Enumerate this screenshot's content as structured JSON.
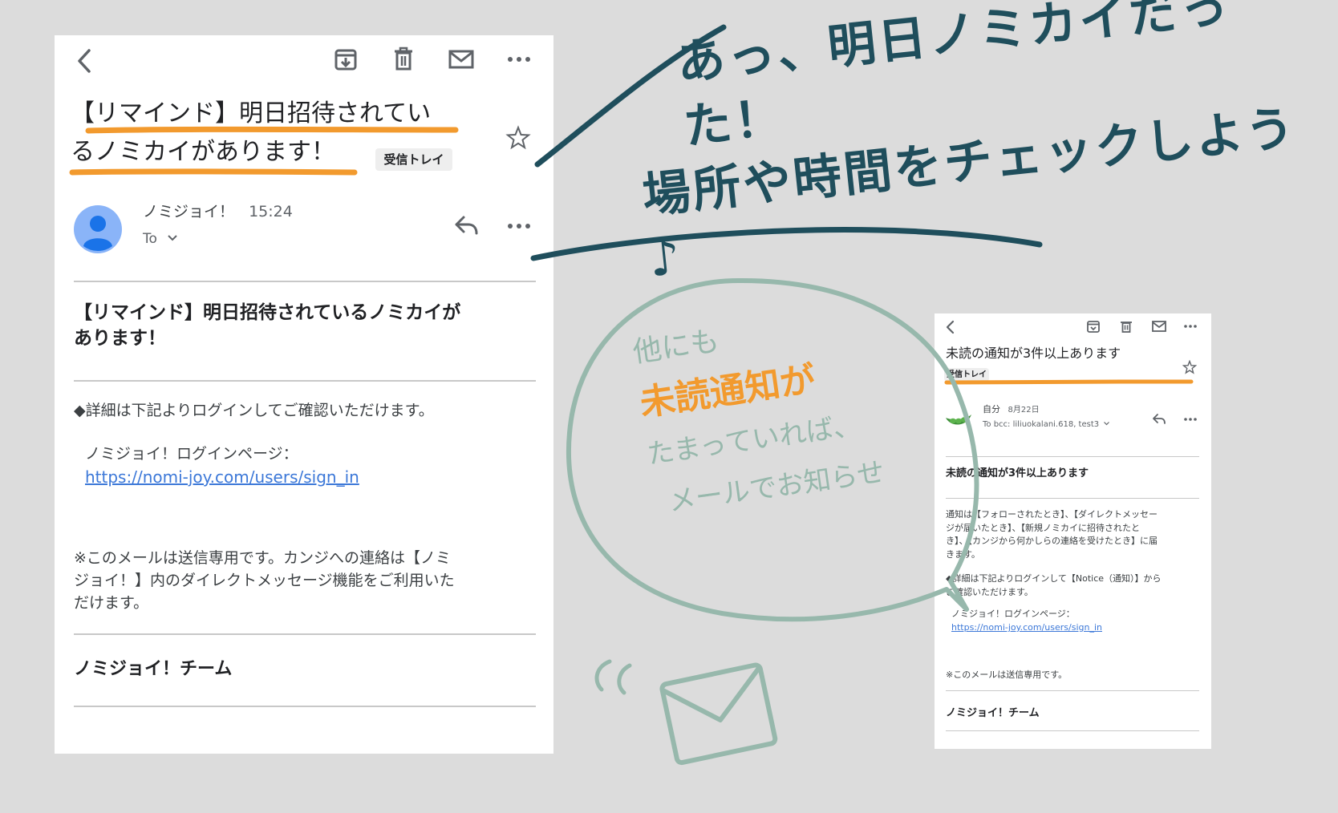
{
  "main_email": {
    "subject": "【リマインド】明日招待されているノミカイがあります！",
    "label": "受信トレイ",
    "sender": "ノミジョイ！",
    "time": "15:24",
    "to": "To",
    "body_heading_line1": "【リマインド】明日招待されているノミカイが",
    "body_heading_line2": "あります！",
    "details": "◆詳細は下記よりログインしてご確認いただけます。",
    "login_label": "ノミジョイ！ログインページ：",
    "login_url": "https://nomi-joy.com/users/sign_in",
    "note_line1": "※このメールは送信専用です。カンジへの連絡は【ノミ",
    "note_line2": "ジョイ！】内のダイレクトメッセージ機能をご利用いた",
    "note_line3": "だけます。",
    "signature": "ノミジョイ！チーム"
  },
  "second_email": {
    "subject": "未読の通知が3件以上あります",
    "label": "受信トレイ",
    "sender": "自分",
    "date": "8月22日",
    "to": "To bcc: liliuokalani.618, test3",
    "body_heading": "未読の通知が3件以上あります",
    "body_line1": "通知は【フォローされたとき】、【ダイレクトメッセー",
    "body_line2": "ジが届いたとき】、【新規ノミカイに招待されたと",
    "body_line3": "き】、【カンジから何かしらの連絡を受けたとき】に届",
    "body_line4": "きます。",
    "details_line1": "◆詳細は下記よりログインして【Notice（通知）】から",
    "details_line2": "ご確認いただけます。",
    "login_label": "ノミジョイ！ログインページ：",
    "login_url": "https://nomi-joy.com/users/sign_in",
    "note": "※このメールは送信専用です。",
    "signature": "ノミジョイ！チーム"
  },
  "annotations": {
    "headline_line1": "あっ、明日ノミカイだった！",
    "headline_line2": "場所や時間をチェックしよう♪",
    "bubble_line1": "他にも",
    "bubble_line2": "未読通知が",
    "bubble_line3": "たまっていれば、",
    "bubble_line4": "メールでお知らせ"
  },
  "colors": {
    "background": "#dcdcdc",
    "underline": "#f29a2e",
    "headline_ink": "#1f4e5c",
    "bubble_ink": "#97b8ac",
    "bubble_highlight": "#f29a2e",
    "link": "#3c78d8",
    "avatar": "#8ab4f8"
  }
}
